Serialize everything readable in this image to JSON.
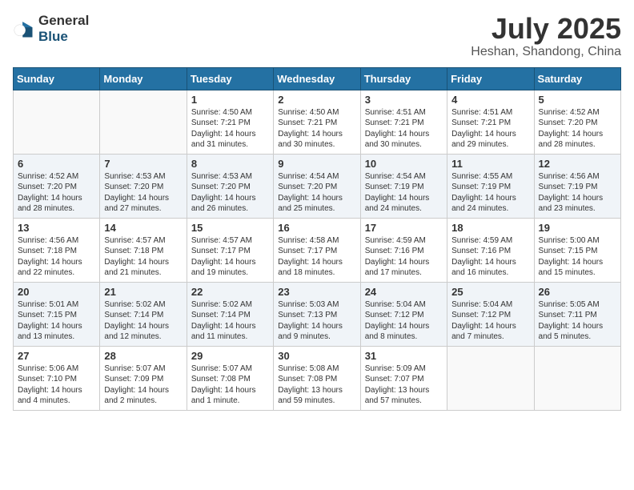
{
  "header": {
    "logo_general": "General",
    "logo_blue": "Blue",
    "month": "July 2025",
    "location": "Heshan, Shandong, China"
  },
  "days_of_week": [
    "Sunday",
    "Monday",
    "Tuesday",
    "Wednesday",
    "Thursday",
    "Friday",
    "Saturday"
  ],
  "weeks": [
    [
      {
        "day": "",
        "info": ""
      },
      {
        "day": "",
        "info": ""
      },
      {
        "day": "1",
        "info": "Sunrise: 4:50 AM\nSunset: 7:21 PM\nDaylight: 14 hours\nand 31 minutes."
      },
      {
        "day": "2",
        "info": "Sunrise: 4:50 AM\nSunset: 7:21 PM\nDaylight: 14 hours\nand 30 minutes."
      },
      {
        "day": "3",
        "info": "Sunrise: 4:51 AM\nSunset: 7:21 PM\nDaylight: 14 hours\nand 30 minutes."
      },
      {
        "day": "4",
        "info": "Sunrise: 4:51 AM\nSunset: 7:21 PM\nDaylight: 14 hours\nand 29 minutes."
      },
      {
        "day": "5",
        "info": "Sunrise: 4:52 AM\nSunset: 7:20 PM\nDaylight: 14 hours\nand 28 minutes."
      }
    ],
    [
      {
        "day": "6",
        "info": "Sunrise: 4:52 AM\nSunset: 7:20 PM\nDaylight: 14 hours\nand 28 minutes."
      },
      {
        "day": "7",
        "info": "Sunrise: 4:53 AM\nSunset: 7:20 PM\nDaylight: 14 hours\nand 27 minutes."
      },
      {
        "day": "8",
        "info": "Sunrise: 4:53 AM\nSunset: 7:20 PM\nDaylight: 14 hours\nand 26 minutes."
      },
      {
        "day": "9",
        "info": "Sunrise: 4:54 AM\nSunset: 7:20 PM\nDaylight: 14 hours\nand 25 minutes."
      },
      {
        "day": "10",
        "info": "Sunrise: 4:54 AM\nSunset: 7:19 PM\nDaylight: 14 hours\nand 24 minutes."
      },
      {
        "day": "11",
        "info": "Sunrise: 4:55 AM\nSunset: 7:19 PM\nDaylight: 14 hours\nand 24 minutes."
      },
      {
        "day": "12",
        "info": "Sunrise: 4:56 AM\nSunset: 7:19 PM\nDaylight: 14 hours\nand 23 minutes."
      }
    ],
    [
      {
        "day": "13",
        "info": "Sunrise: 4:56 AM\nSunset: 7:18 PM\nDaylight: 14 hours\nand 22 minutes."
      },
      {
        "day": "14",
        "info": "Sunrise: 4:57 AM\nSunset: 7:18 PM\nDaylight: 14 hours\nand 21 minutes."
      },
      {
        "day": "15",
        "info": "Sunrise: 4:57 AM\nSunset: 7:17 PM\nDaylight: 14 hours\nand 19 minutes."
      },
      {
        "day": "16",
        "info": "Sunrise: 4:58 AM\nSunset: 7:17 PM\nDaylight: 14 hours\nand 18 minutes."
      },
      {
        "day": "17",
        "info": "Sunrise: 4:59 AM\nSunset: 7:16 PM\nDaylight: 14 hours\nand 17 minutes."
      },
      {
        "day": "18",
        "info": "Sunrise: 4:59 AM\nSunset: 7:16 PM\nDaylight: 14 hours\nand 16 minutes."
      },
      {
        "day": "19",
        "info": "Sunrise: 5:00 AM\nSunset: 7:15 PM\nDaylight: 14 hours\nand 15 minutes."
      }
    ],
    [
      {
        "day": "20",
        "info": "Sunrise: 5:01 AM\nSunset: 7:15 PM\nDaylight: 14 hours\nand 13 minutes."
      },
      {
        "day": "21",
        "info": "Sunrise: 5:02 AM\nSunset: 7:14 PM\nDaylight: 14 hours\nand 12 minutes."
      },
      {
        "day": "22",
        "info": "Sunrise: 5:02 AM\nSunset: 7:14 PM\nDaylight: 14 hours\nand 11 minutes."
      },
      {
        "day": "23",
        "info": "Sunrise: 5:03 AM\nSunset: 7:13 PM\nDaylight: 14 hours\nand 9 minutes."
      },
      {
        "day": "24",
        "info": "Sunrise: 5:04 AM\nSunset: 7:12 PM\nDaylight: 14 hours\nand 8 minutes."
      },
      {
        "day": "25",
        "info": "Sunrise: 5:04 AM\nSunset: 7:12 PM\nDaylight: 14 hours\nand 7 minutes."
      },
      {
        "day": "26",
        "info": "Sunrise: 5:05 AM\nSunset: 7:11 PM\nDaylight: 14 hours\nand 5 minutes."
      }
    ],
    [
      {
        "day": "27",
        "info": "Sunrise: 5:06 AM\nSunset: 7:10 PM\nDaylight: 14 hours\nand 4 minutes."
      },
      {
        "day": "28",
        "info": "Sunrise: 5:07 AM\nSunset: 7:09 PM\nDaylight: 14 hours\nand 2 minutes."
      },
      {
        "day": "29",
        "info": "Sunrise: 5:07 AM\nSunset: 7:08 PM\nDaylight: 14 hours\nand 1 minute."
      },
      {
        "day": "30",
        "info": "Sunrise: 5:08 AM\nSunset: 7:08 PM\nDaylight: 13 hours\nand 59 minutes."
      },
      {
        "day": "31",
        "info": "Sunrise: 5:09 AM\nSunset: 7:07 PM\nDaylight: 13 hours\nand 57 minutes."
      },
      {
        "day": "",
        "info": ""
      },
      {
        "day": "",
        "info": ""
      }
    ]
  ]
}
